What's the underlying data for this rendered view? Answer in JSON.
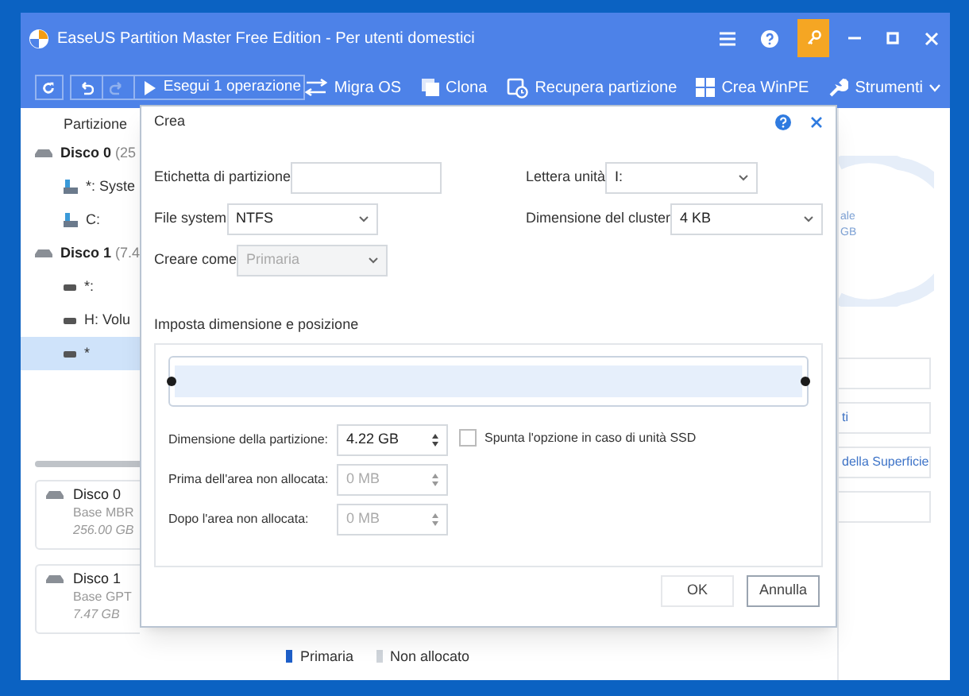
{
  "window": {
    "title": "EaseUS Partition Master Free Edition - Per utenti domestici"
  },
  "history": [
    {
      "kind": "undo",
      "disabled": false
    },
    {
      "kind": "redo",
      "disabled": true
    }
  ],
  "run_button": {
    "label": "Esegui 1 operazione"
  },
  "toolbar": [
    {
      "kind": "arrows",
      "label": "Migra OS"
    },
    {
      "kind": "copy",
      "label": "Clona"
    },
    {
      "kind": "recover",
      "label": "Recupera partizione"
    },
    {
      "kind": "windows",
      "label": "Crea WinPE"
    },
    {
      "kind": "wrench",
      "label": "Strumenti"
    }
  ],
  "partition_list": {
    "header": "Partizione",
    "items": [
      {
        "label": "Disco 0",
        "detail": "(25",
        "selected": false,
        "children": [
          {
            "label": "*: Syste",
            "kind": "system",
            "selected": false
          },
          {
            "label": "C:",
            "kind": "system",
            "selected": false
          }
        ]
      },
      {
        "label": "Disco 1",
        "detail": "(7.4",
        "selected": false,
        "children": [
          {
            "label": "*:",
            "kind": "usb",
            "selected": false
          },
          {
            "label": "H: Volu",
            "kind": "usb",
            "selected": false
          },
          {
            "label": "*",
            "kind": "usb",
            "selected": true
          }
        ]
      }
    ]
  },
  "disk_cards": [
    {
      "name": "Disco 0",
      "type": "Base MBR",
      "size": "256.00 GB"
    },
    {
      "name": "Disco 1",
      "type": "Base GPT",
      "size": "7.47 GB"
    }
  ],
  "legend": [
    {
      "label": "Primaria",
      "color": "#1e5fc9"
    },
    {
      "label": "Non allocato",
      "color": "#cfd4da"
    }
  ],
  "right_panel": {
    "donut_labels": [
      "ale",
      "GB"
    ],
    "actions": [
      "ti",
      "della Superficie"
    ]
  },
  "dialog": {
    "title": "Crea",
    "left_fields": [
      {
        "label": "Etichetta di partizione",
        "kind": "text",
        "disabled": false
      },
      {
        "label": "File system",
        "kind": "select",
        "value": "NTFS",
        "disabled": false
      },
      {
        "label": "Creare come",
        "kind": "select",
        "value": "Primaria",
        "disabled": true
      }
    ],
    "right_fields": [
      {
        "label": "Lettera unità",
        "kind": "select",
        "value": "I:",
        "disabled": false
      },
      {
        "label": "Dimensione del cluster",
        "kind": "select",
        "value": "4 KB",
        "disabled": false
      }
    ],
    "section_title": "Imposta dimensione e posizione",
    "slider": {
      "level": 1
    },
    "size_rows": [
      {
        "label": "Dimensione della partizione:",
        "value": "4.22 GB",
        "disabled": false
      },
      {
        "label": "Prima dell'area non allocata:",
        "value": "0 MB",
        "disabled": true
      },
      {
        "label": "Dopo l'area non allocata:",
        "value": "0 MB",
        "disabled": true
      }
    ],
    "ssd_option": {
      "label": "Spunta l'opzione in caso di unità SSD",
      "checked": false
    },
    "buttons": [
      "OK",
      "Annulla"
    ]
  }
}
